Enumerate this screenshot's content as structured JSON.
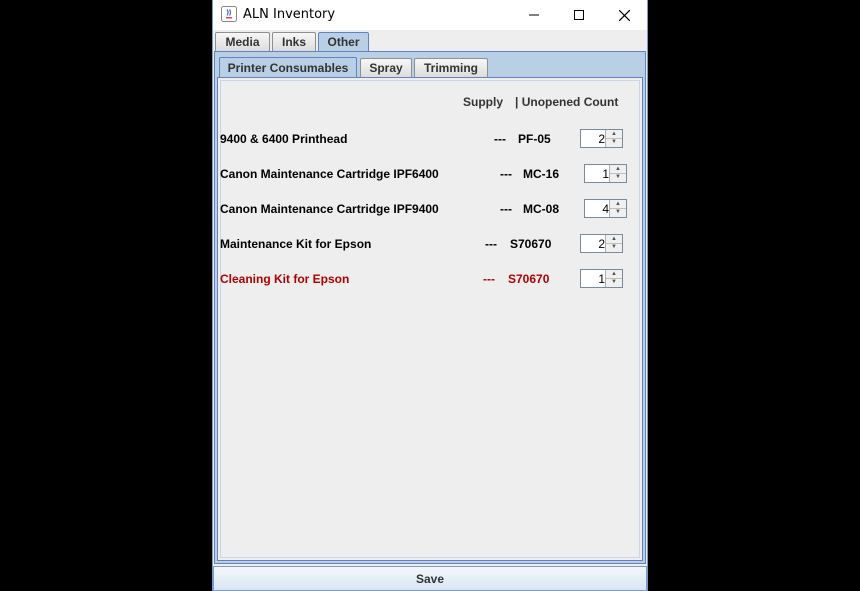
{
  "window": {
    "title": "ALN Inventory"
  },
  "outer_tabs": [
    "Media",
    "Inks",
    "Other"
  ],
  "outer_selected": "Other",
  "inner_tabs": [
    "Printer Consumables",
    "Spray",
    "Trimming"
  ],
  "inner_selected": "Printer Consumables",
  "headers": {
    "supply": "Supply",
    "count": "| Unopened Count"
  },
  "items": [
    {
      "name": "9400 & 6400 Printhead",
      "dash": "---",
      "code": "PF-05",
      "count": "2",
      "alert": false
    },
    {
      "name": "Canon Maintenance Cartridge IPF6400",
      "dash": "---",
      "code": "MC-16",
      "count": "1",
      "alert": false
    },
    {
      "name": "Canon Maintenance Cartridge IPF9400",
      "dash": "---",
      "code": "MC-08",
      "count": "4",
      "alert": false
    },
    {
      "name": "Maintenance Kit for Epson",
      "dash": "---",
      "code": "S70670",
      "count": "2",
      "alert": false
    },
    {
      "name": "Cleaning Kit for Epson",
      "dash": "---",
      "code": "S70670",
      "count": "1",
      "alert": true
    }
  ],
  "save_label": "Save",
  "colors": {
    "alert": "#b00000",
    "selected_tab": "#b8cfe5"
  }
}
